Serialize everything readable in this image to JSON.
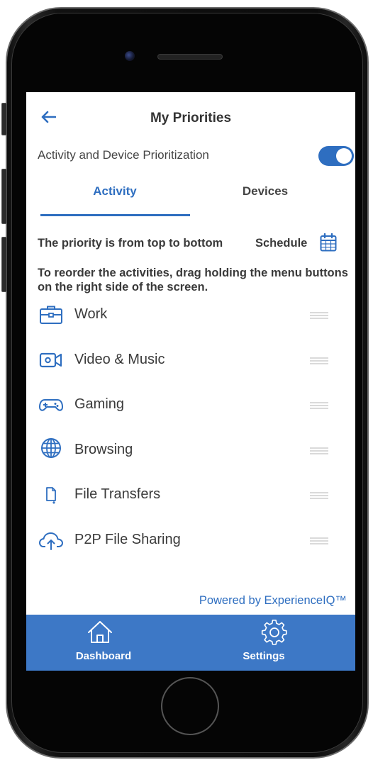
{
  "header": {
    "title": "My Priorities"
  },
  "toggle": {
    "label": "Activity and Device Prioritization",
    "on": true
  },
  "tabs": [
    {
      "label": "Activity",
      "active": true
    },
    {
      "label": "Devices",
      "active": false
    }
  ],
  "priority_note": "The priority is from top to bottom",
  "schedule_label": "Schedule",
  "instructions": "To reorder the activities, drag holding the menu buttons on the right side of the screen.",
  "activities": [
    {
      "label": "Work",
      "icon": "briefcase-icon"
    },
    {
      "label": "Video & Music",
      "icon": "video-camera-icon"
    },
    {
      "label": "Gaming",
      "icon": "gamepad-icon"
    },
    {
      "label": "Browsing",
      "icon": "globe-icon"
    },
    {
      "label": "File Transfers",
      "icon": "file-transfer-icon"
    },
    {
      "label": "P2P File Sharing",
      "icon": "cloud-upload-icon"
    }
  ],
  "powered_by": "Powered by ExperienceIQ™",
  "nav": [
    {
      "label": "Dashboard",
      "icon": "home-icon"
    },
    {
      "label": "Settings",
      "icon": "gear-icon"
    }
  ],
  "colors": {
    "accent": "#2e6ec0",
    "nav_bg": "#3d78c6",
    "text": "#3a3a3a"
  }
}
